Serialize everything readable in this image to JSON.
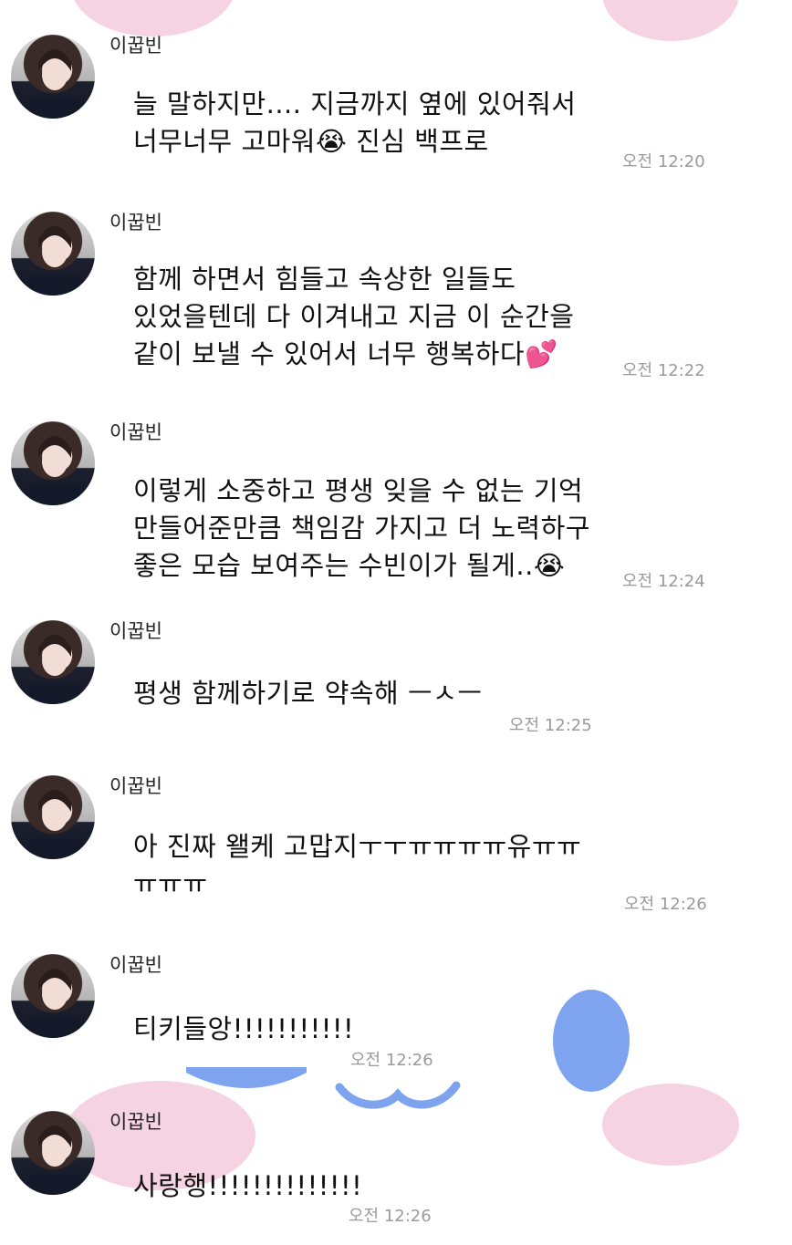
{
  "colors": {
    "background": "#ffffff",
    "time": "#9a9a9a",
    "pink_blob": "#f6d3e2",
    "blue_blob": "#7ea3ef"
  },
  "messages": [
    {
      "sender": "이꿉빈",
      "lines": [
        "늘 말하지만.... 지금까지 옆에 있어줘서",
        "너무너무 고마워😭 진심 백프로"
      ],
      "time": "오전 12:20"
    },
    {
      "sender": "이꿉빈",
      "lines": [
        "함께 하면서 힘들고 속상한 일들도",
        "있었을텐데 다 이겨내고 지금 이 순간을",
        "같이 보낼 수 있어서 너무 행복하다💕"
      ],
      "time": "오전 12:22"
    },
    {
      "sender": "이꿉빈",
      "lines": [
        "이렇게 소중하고 평생 잊을 수 없는 기억",
        "만들어준만큼 책임감 가지고 더 노력하구",
        "좋은 모습 보여주는 수빈이가 될게..😭"
      ],
      "time": "오전 12:24"
    },
    {
      "sender": "이꿉빈",
      "lines": [
        "평생 함께하기로 약속해 ㅡㅅㅡ"
      ],
      "time": "오전 12:25"
    },
    {
      "sender": "이꿉빈",
      "lines": [
        "아 진짜 왤케 고맙지ㅜㅜㅠㅠㅠㅠ유ㅠㅠ",
        "ㅠㅠㅠ"
      ],
      "time": "오전 12:26"
    },
    {
      "sender": "이꿉빈",
      "lines": [
        "티키들앙!!!!!!!!!!!"
      ],
      "time": "오전 12:26"
    },
    {
      "sender": "이꿉빈",
      "lines": [
        "사랑행!!!!!!!!!!!!!!"
      ],
      "time": "오전 12:26"
    }
  ]
}
